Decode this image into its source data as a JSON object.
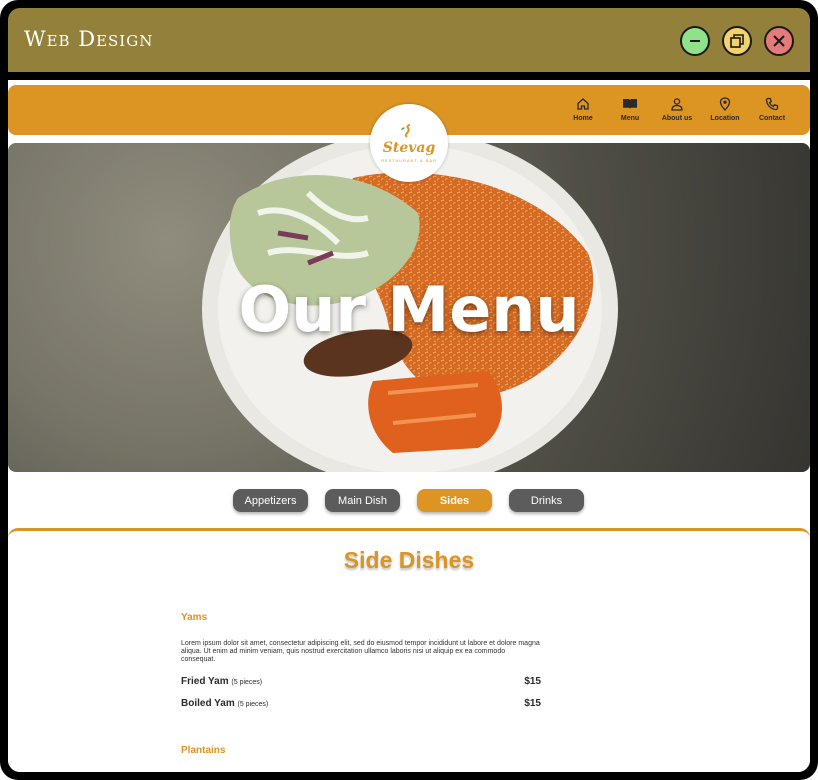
{
  "window": {
    "title": "Web Design"
  },
  "nav": {
    "items": [
      {
        "label": "Home",
        "icon": "home-icon"
      },
      {
        "label": "Menu",
        "icon": "book-icon"
      },
      {
        "label": "About us",
        "icon": "person-icon"
      },
      {
        "label": "Location",
        "icon": "location-pin-icon"
      },
      {
        "label": "Contact",
        "icon": "phone-icon"
      }
    ]
  },
  "logo": {
    "word": "Stevag",
    "sub": "RESTAURANT & BAR"
  },
  "hero": {
    "title": "Our Menu"
  },
  "tabs": [
    {
      "label": "Appetizers",
      "active": false
    },
    {
      "label": "Main Dish",
      "active": false
    },
    {
      "label": "Sides",
      "active": true
    },
    {
      "label": "Drinks",
      "active": false
    }
  ],
  "content": {
    "section_title": "Side Dishes",
    "groups": [
      {
        "title": "Yams",
        "description": "Lorem ipsum dolor sit amet, consectetur adipiscing elit, sed do eiusmod tempor incididunt ut labore et dolore magna aliqua. Ut enim ad minim veniam, quis nostrud exercitation ullamco laboris nisi ut aliquip ex ea commodo consequat.",
        "items": [
          {
            "name": "Fried Yam",
            "note": "(5 pieces)",
            "price": "$15"
          },
          {
            "name": "Boiled Yam",
            "note": "(5 pieces)",
            "price": "$15"
          }
        ]
      },
      {
        "title": "Plantains"
      }
    ]
  },
  "colors": {
    "accent": "#dc9423",
    "titlebar": "#93803a",
    "tab_inactive": "#5c5c5c"
  }
}
